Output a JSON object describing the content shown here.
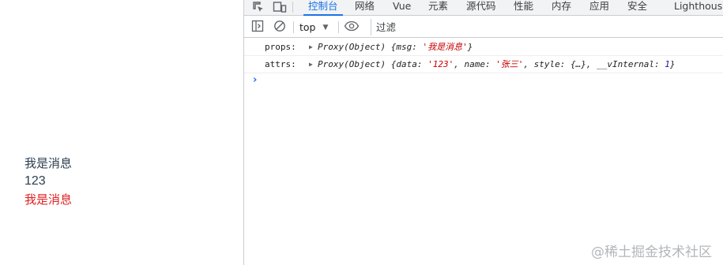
{
  "app": {
    "line1": "我是消息",
    "line2": "123",
    "line3": "我是消息"
  },
  "devtools": {
    "tabs": [
      "控制台",
      "网络",
      "Vue",
      "元素",
      "源代码",
      "性能",
      "内存",
      "应用",
      "安全",
      "Lighthouse"
    ],
    "active_tab": "控制台",
    "toolbar": {
      "context": "top",
      "filter_placeholder": "过滤"
    },
    "console": {
      "rows": [
        {
          "label": "props:",
          "prefix": "Proxy(Object) {msg: ",
          "msg": "'我是消息'",
          "suffix": "}"
        },
        {
          "label": "attrs:",
          "prefix": "Proxy(Object) {data: ",
          "data": "'123'",
          "mid1": ", name: ",
          "name": "'张三'",
          "mid2": ", style: {…}, __vInternal: ",
          "vInternal": "1",
          "suffix": "}"
        }
      ]
    }
  },
  "watermark": "@稀土掘金技术社区",
  "colors": {
    "accent": "#1a73e8",
    "string": "#c80000",
    "number": "#1a1aa6",
    "red_text": "#e02020"
  },
  "icons": [
    "inspect-element-icon",
    "device-toggle-icon",
    "sidebar-toggle-icon",
    "clear-console-icon",
    "live-expression-eye-icon",
    "prompt-chevron-icon",
    "expand-triangle-icon"
  ]
}
